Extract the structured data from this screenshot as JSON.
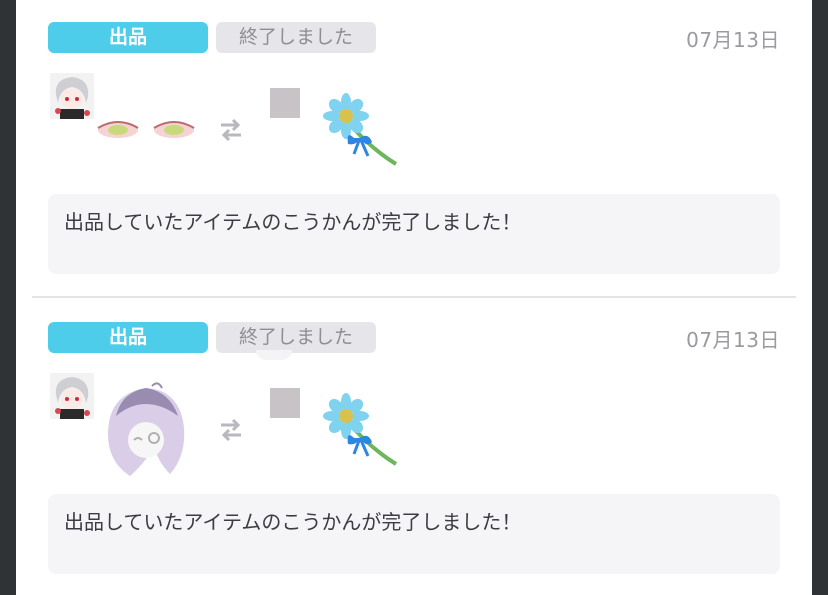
{
  "colors": {
    "listing_badge_bg": "#4ecdea",
    "status_badge_bg": "#e6e6ea",
    "message_bg": "#f5f5f7",
    "outer_bg": "#2f3335"
  },
  "entries": [
    {
      "badge_label": "出品",
      "status_label": "終了しました",
      "date": "07月13日",
      "offered_item_icon": "eyes-makeup-item",
      "swap_icon": "exchange-arrows-icon",
      "received_item_icon": "blue-flower-item",
      "message": "出品していたアイテムのこうかんが完了しました！"
    },
    {
      "badge_label": "出品",
      "status_label": "終了しました",
      "date": "07月13日",
      "offered_item_icon": "lavender-hair-item",
      "swap_icon": "exchange-arrows-icon",
      "received_item_icon": "blue-flower-item",
      "message": "出品していたアイテムのこうかんが完了しました！"
    }
  ]
}
